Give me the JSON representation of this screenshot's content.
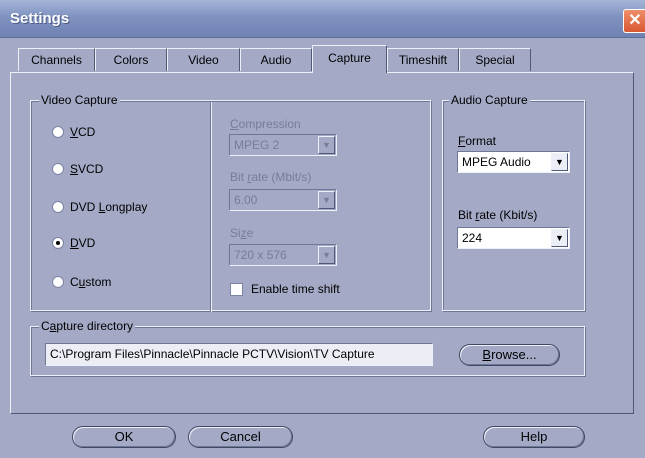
{
  "window": {
    "title": "Settings",
    "close_glyph": "✕"
  },
  "tabs": [
    {
      "label": "Channels"
    },
    {
      "label": "Colors"
    },
    {
      "label": "Video"
    },
    {
      "label": "Audio"
    },
    {
      "label": "Capture",
      "active": true
    },
    {
      "label": "Timeshift"
    },
    {
      "label": "Special"
    }
  ],
  "video_capture": {
    "legend": "Video Capture",
    "options": [
      {
        "pre": "",
        "u": "V",
        "post": "CD",
        "checked": false
      },
      {
        "pre": "",
        "u": "S",
        "post": "VCD",
        "checked": false
      },
      {
        "pre": "DVD ",
        "u": "L",
        "post": "ongplay",
        "checked": false
      },
      {
        "pre": "",
        "u": "D",
        "post": "VD",
        "checked": true
      },
      {
        "pre": "C",
        "u": "u",
        "post": "stom",
        "checked": false
      }
    ],
    "compression": {
      "label_pre": "",
      "label_u": "C",
      "label_post": "ompression",
      "value": "MPEG 2"
    },
    "bitrate": {
      "label_pre": "Bit ",
      "label_u": "r",
      "label_post": "ate (Mbit/s)",
      "value": "6.00"
    },
    "size": {
      "label_pre": "Si",
      "label_u": "z",
      "label_post": "e",
      "value": "720 x 576"
    },
    "timeshift": {
      "label": "Enable time shift",
      "checked": false
    }
  },
  "audio_capture": {
    "legend": "Audio Capture",
    "format": {
      "label_pre": "",
      "label_u": "F",
      "label_post": "ormat",
      "value": "MPEG Audio"
    },
    "bitrate": {
      "label_pre": "Bit ",
      "label_u": "r",
      "label_post": "ate (Kbit/s)",
      "value": "224"
    }
  },
  "capture_directory": {
    "legend_pre": "C",
    "legend_u": "a",
    "legend_post": "pture directory",
    "path": "C:\\Program Files\\Pinnacle\\Pinnacle PCTV\\Vision\\TV Capture",
    "browse_pre": "",
    "browse_u": "B",
    "browse_post": "rowse..."
  },
  "footer": {
    "ok": "OK",
    "cancel": "Cancel",
    "help": "Help"
  },
  "colors": {
    "face": "#a4aac6",
    "title_bar": "#7f92c0",
    "close": "#d85731"
  }
}
